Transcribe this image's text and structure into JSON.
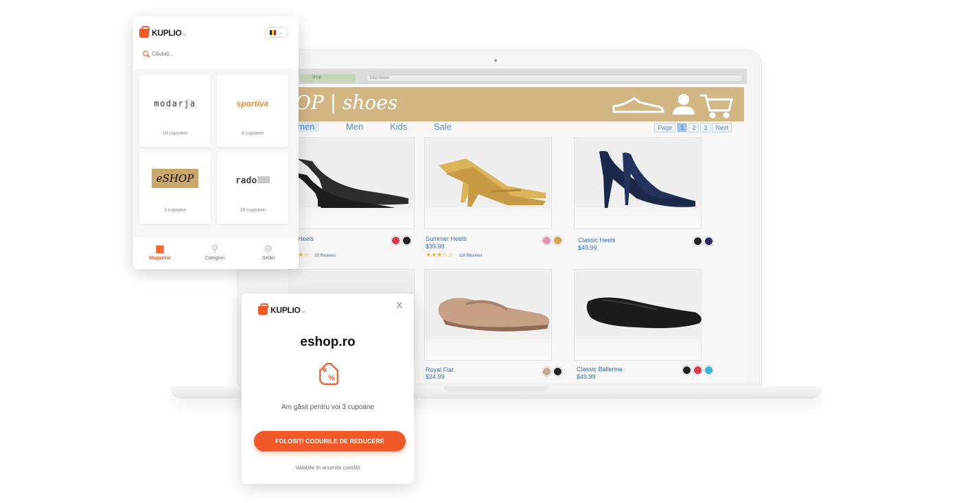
{
  "browser": {
    "tab_label": "Shop",
    "url": "http://www"
  },
  "shop": {
    "logo": "OP | shoes",
    "nav": [
      "omen",
      "Men",
      "Kids",
      "Sale"
    ],
    "pager": [
      "Page",
      "1",
      "2",
      "3",
      "Next"
    ],
    "products": [
      {
        "name": "Heels",
        "price": "",
        "rating": "★★☆",
        "reviews": "20 Reviews",
        "colors": [
          "#d9394c",
          "#222222"
        ]
      },
      {
        "name": "Summer Heels",
        "price": "$39.99",
        "rating": "★★★☆☆",
        "reviews": "118 Reviews",
        "colors": [
          "#e98fb4",
          "#d4a54a"
        ]
      },
      {
        "name": "Classic Heels",
        "price": "$49.99",
        "rating": "",
        "reviews": "",
        "colors": [
          "#222222",
          "#2a2a6a"
        ]
      },
      {
        "name": "",
        "price": "",
        "rating": "",
        "reviews": "",
        "colors": []
      },
      {
        "name": "Royal Flat",
        "price": "$24.99",
        "rating": "",
        "reviews": "",
        "colors": [
          "#c8a58c",
          "#222222"
        ]
      },
      {
        "name": "Classic Ballerina",
        "price": "$49.99",
        "rating": "",
        "reviews": "",
        "colors": [
          "#222222",
          "#d9394c",
          "#3bb8d8"
        ]
      }
    ]
  },
  "stores_popup": {
    "brand": "KUPLIO",
    "brand_tld": ".ro",
    "search_placeholder": "Căutați...",
    "stores": [
      {
        "name": "modarja",
        "coupons": "18 cupoane"
      },
      {
        "name": "sportiva",
        "coupons": "4 cupoane"
      },
      {
        "name": "eSHOP",
        "coupons": "3 cupoane"
      },
      {
        "name": "rado",
        "coupons": "28 cupoane"
      }
    ],
    "bottom_nav": [
      "Magazine",
      "Categorii",
      "Setări"
    ]
  },
  "coupon_popup": {
    "brand": "KUPLIO",
    "brand_tld": ".ro",
    "close": "X",
    "shop": "eshop.ro",
    "found_text": "Am găsit pentru voi 3 cupoane",
    "cta": "FOLOSIȚI CODURILE DE REDUCERE",
    "conditions": "Valabile în anumite condiții"
  },
  "colors": {
    "accent": "#f05a28",
    "shop_header": "#d2b683",
    "shop_link": "#5a8ec8"
  }
}
